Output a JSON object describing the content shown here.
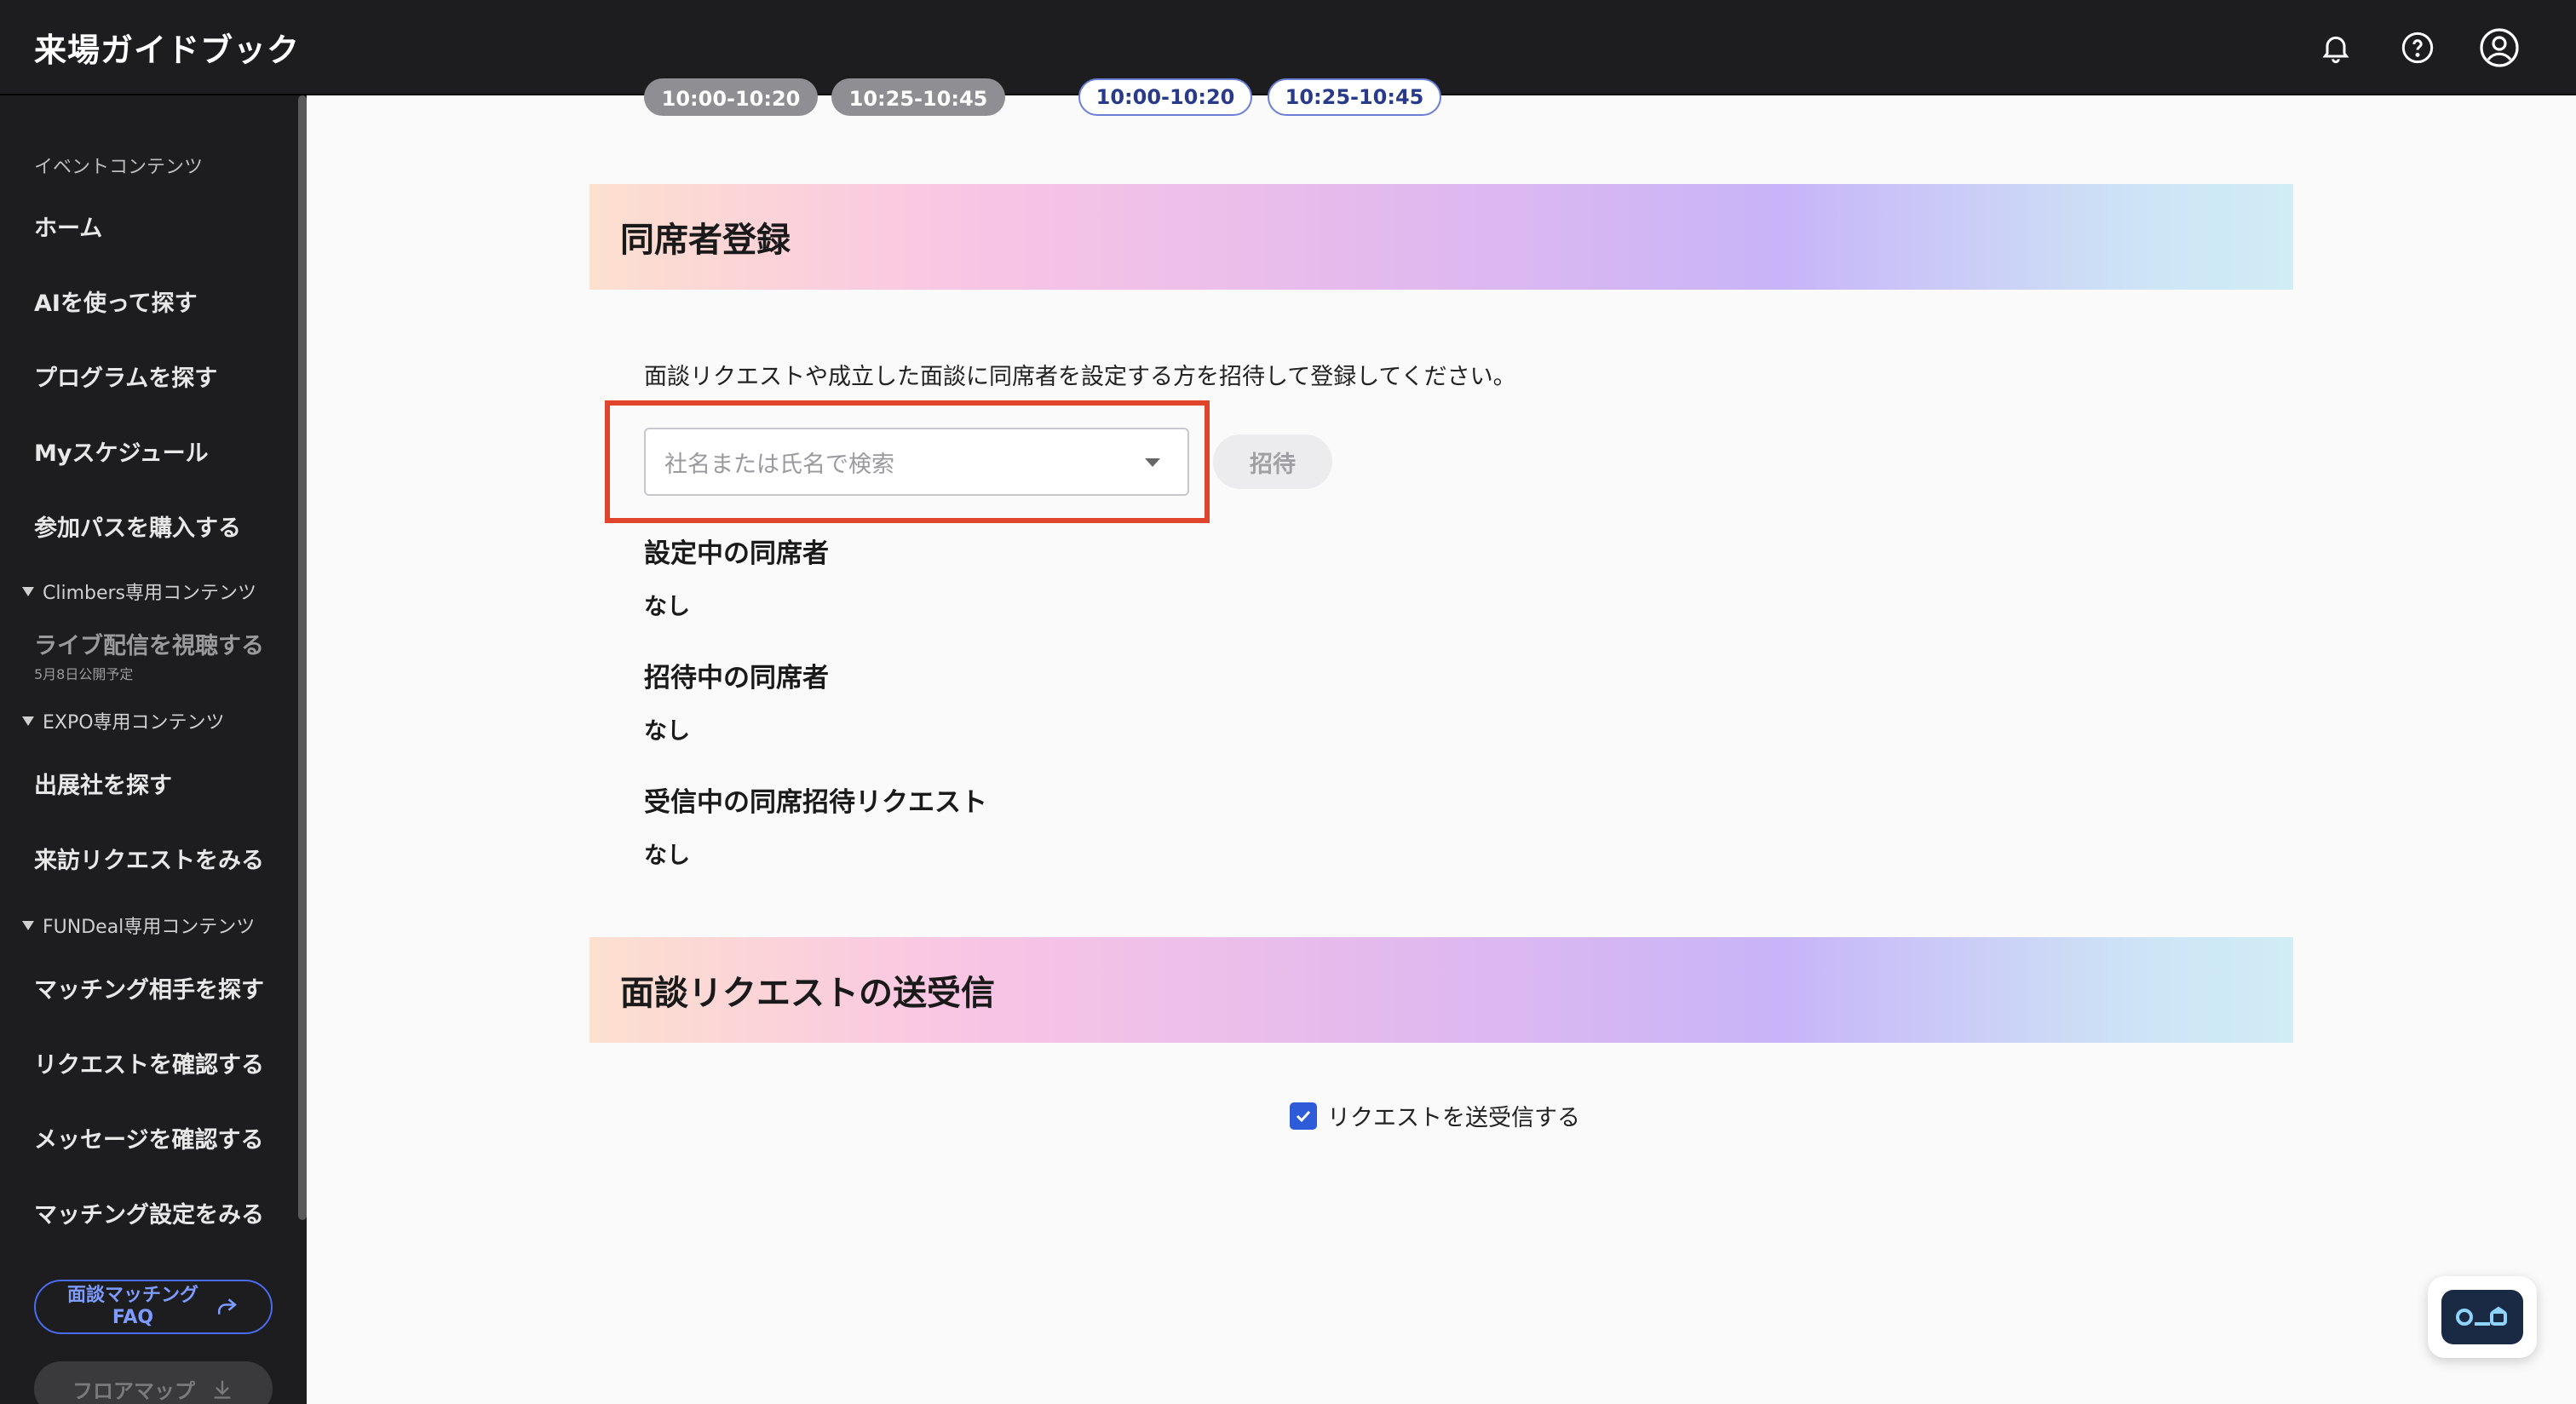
{
  "header": {
    "app_title": "来場ガイドブック",
    "icons": [
      "bell-icon",
      "help-icon",
      "account-icon"
    ]
  },
  "sidebar": {
    "section_label": "イベントコンテンツ",
    "items_main": [
      "ホーム",
      "AIを使って探す",
      "プログラムを探す",
      "Myスケジュール",
      "参加パスを購入する"
    ],
    "group_climbers": "Climbers専用コンテンツ",
    "climbers_item": "ライブ配信を視聴する",
    "climbers_note": "5月8日公開予定",
    "group_expo": "EXPO専用コンテンツ",
    "expo_items": [
      "出展社を探す",
      "来訪リクエストをみる"
    ],
    "group_fundeal": "FUNDeal専用コンテンツ",
    "fundeal_items": [
      "マッチング相手を探す",
      "リクエストを確認する",
      "メッセージを確認する",
      "マッチング設定をみる"
    ],
    "faq_button_line1": "面談マッチング",
    "faq_button_line2": "FAQ",
    "floor_map_button": "フロアマップ"
  },
  "main": {
    "time_slots_dark": [
      "10:00-10:20",
      "10:25-10:45"
    ],
    "time_slots_outline": [
      "10:00-10:20",
      "10:25-10:45"
    ],
    "section1_title": "同席者登録",
    "section1_desc": "面談リクエストや成立した面談に同席者を設定する方を招待して登録してください。",
    "search_placeholder": "社名または氏名で検索",
    "invite_button": "招待",
    "current_attendees_label": "設定中の同席者",
    "current_attendees_value": "なし",
    "inviting_attendees_label": "招待中の同席者",
    "inviting_attendees_value": "なし",
    "incoming_requests_label": "受信中の同席招待リクエスト",
    "incoming_requests_value": "なし",
    "section2_title": "面談リクエストの送受信",
    "request_checkbox_label": "リクエストを送受信する",
    "request_checkbox_checked": true
  },
  "colors": {
    "accent_blue": "#2e5bd8",
    "highlight_red": "#e0442c",
    "header_bg": "#1d1d1f"
  }
}
